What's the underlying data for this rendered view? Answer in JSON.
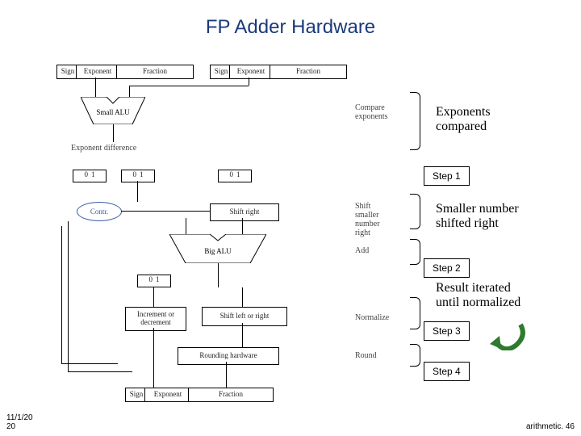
{
  "title": "FP Adder Hardware",
  "annotations": {
    "exp": "Exponents\ncompared",
    "shift": "Smaller number\nshifted right",
    "iterate": "Result iterated\nuntil normalized"
  },
  "steps": {
    "s1": "Step 1",
    "s2": "Step 2",
    "s3": "Step 3",
    "s4": "Step 4"
  },
  "diagram_labels": {
    "sign": "Sign",
    "exponent": "Exponent",
    "fraction": "Fraction",
    "small_alu": "Small ALU",
    "big_alu": "Big ALU",
    "exp_diff": "Exponent\ndifference",
    "control": "Contr.",
    "shift_right": "Shift right",
    "inc_dec": "Increment or\ndecrement",
    "shift_lr": "Shift left or right",
    "rounding": "Rounding hardware",
    "mux0": "0",
    "mux1": "1",
    "op_compare": "Compare\nexponents",
    "op_shift": "Shift smaller\nnumber right",
    "op_add": "Add",
    "op_norm": "Normalize",
    "op_round": "Round"
  },
  "footer": {
    "date": "11/1/20\n20",
    "page": "arithmetic. 46"
  }
}
